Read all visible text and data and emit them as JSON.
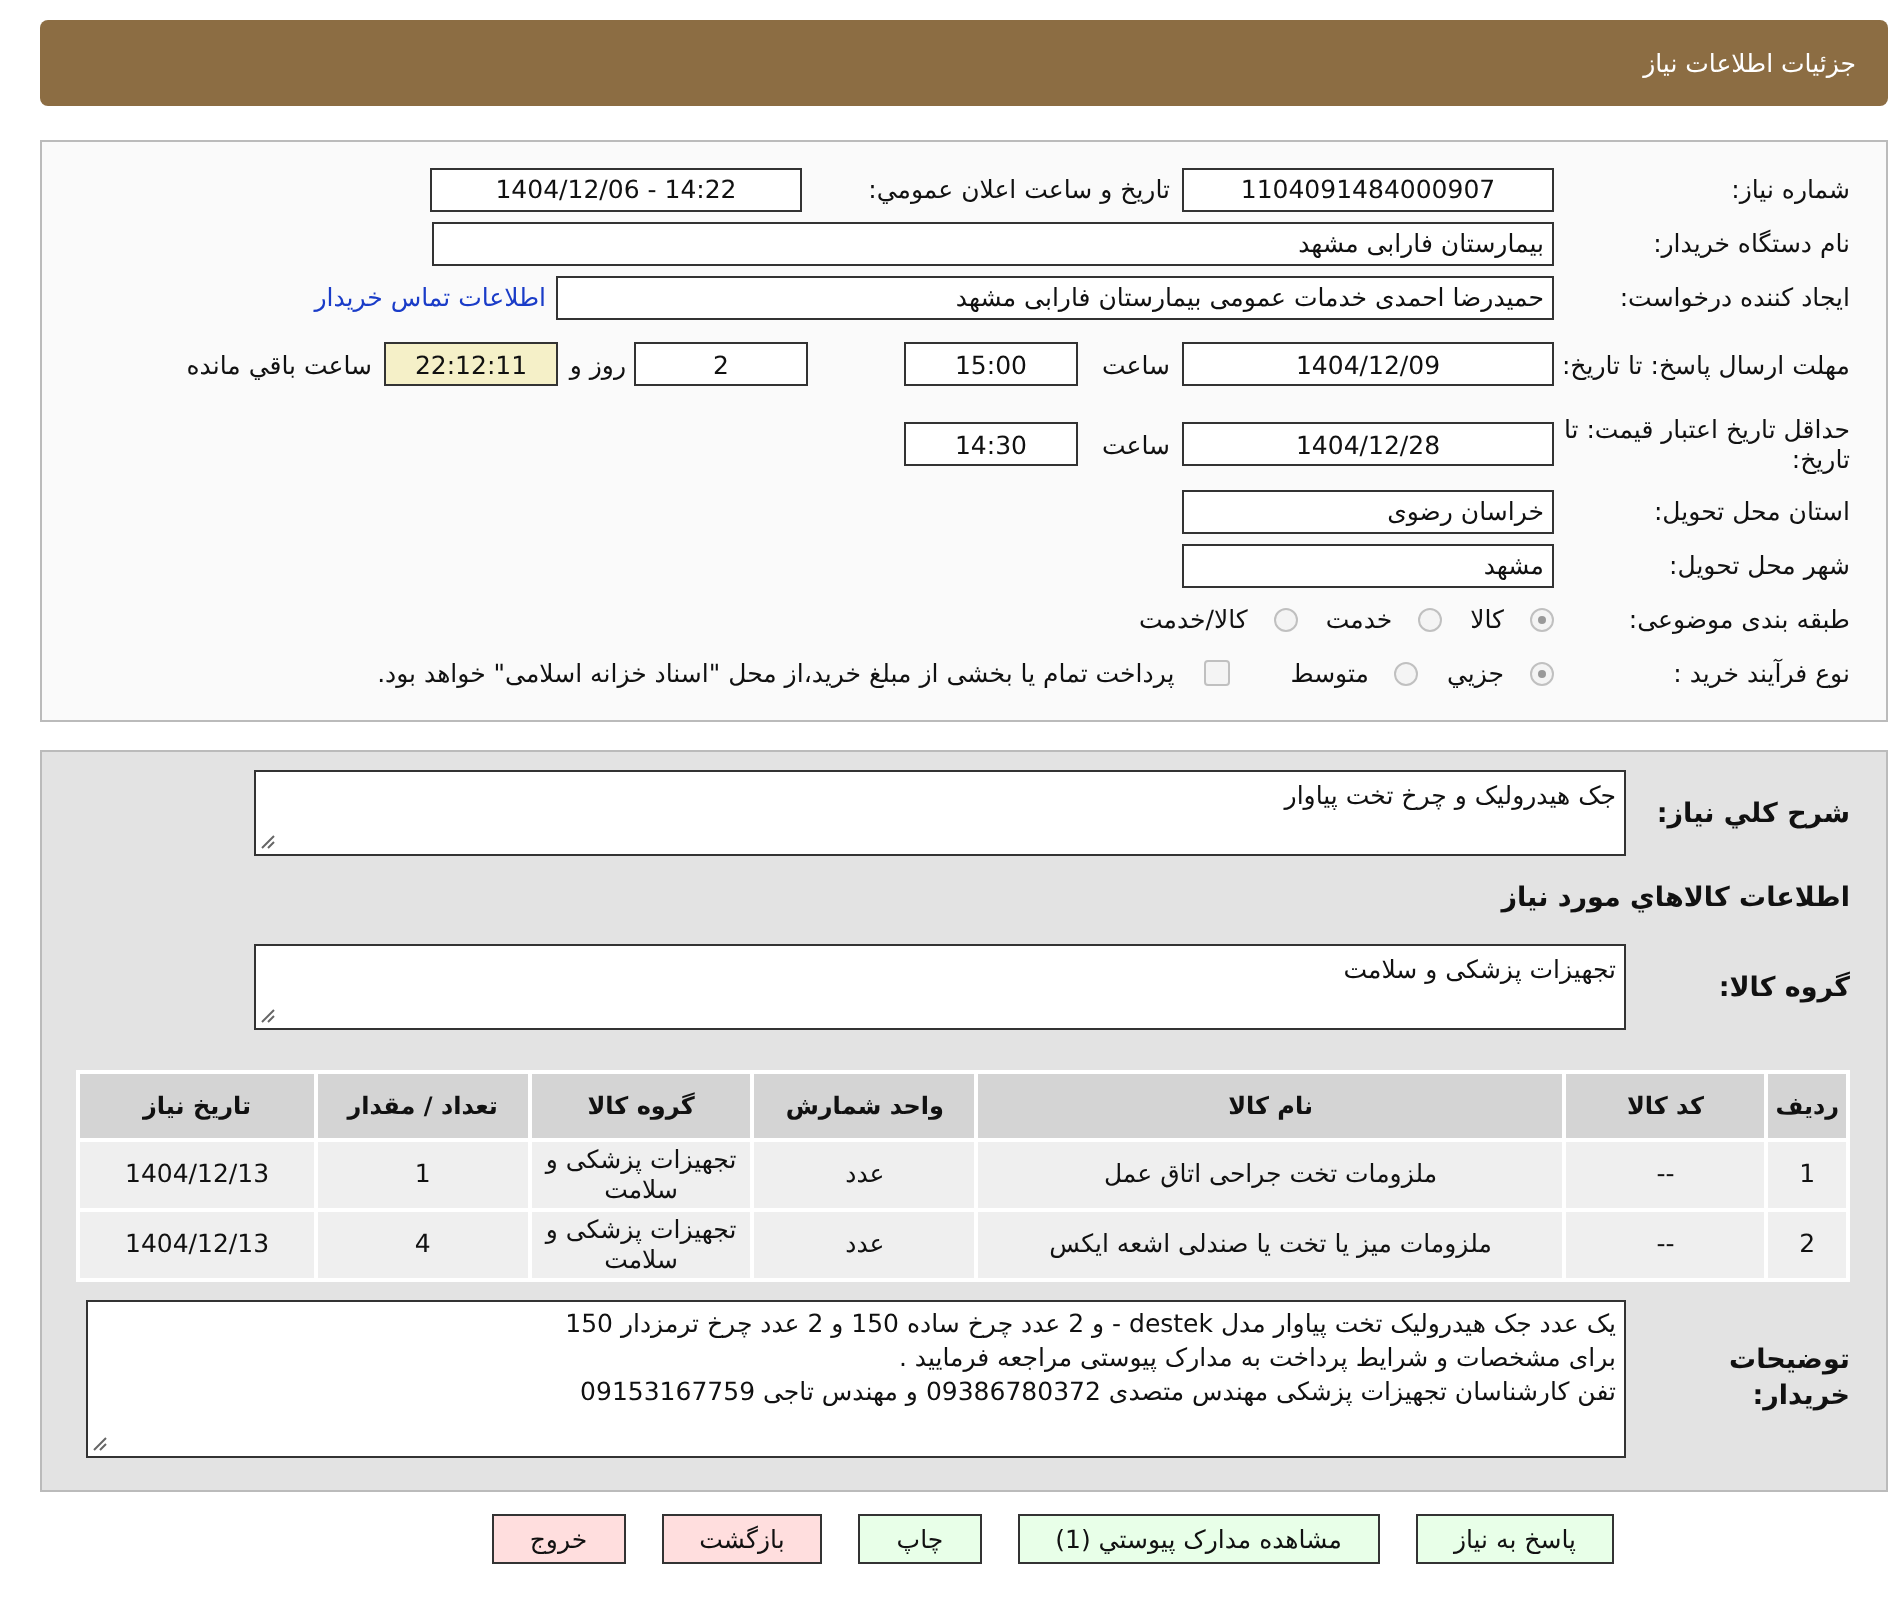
{
  "header": {
    "title": "جزئیات اطلاعات نیاز"
  },
  "need_number": {
    "label": "شماره نیاز:",
    "value": "1104091484000907"
  },
  "announce": {
    "label": "تاریخ و ساعت اعلان عمومي:",
    "value": "1404/12/06 - 14:22"
  },
  "buyer": {
    "label": "نام دستگاه خریدار:",
    "value": "بیمارستان فارابی مشهد"
  },
  "creator": {
    "label": "ایجاد کننده درخواست:",
    "value": "حمیدرضا احمدی خدمات عمومی بیمارستان فارابی مشهد",
    "link": "اطلاعات تماس خریدار"
  },
  "deadline": {
    "label": "مهلت ارسال پاسخ: تا تاریخ:",
    "date": "1404/12/09",
    "time_label": "ساعت",
    "time": "15:00",
    "days": "2",
    "days_label": "روز و",
    "remaining": "22:12:11",
    "remaining_label": "ساعت باقي مانده"
  },
  "validity": {
    "label": "حداقل تاریخ اعتبار قیمت: تا تاریخ:",
    "date": "1404/12/28",
    "time_label": "ساعت",
    "time": "14:30"
  },
  "province": {
    "label": "استان محل تحویل:",
    "value": "خراسان رضوی"
  },
  "city": {
    "label": "شهر محل تحویل:",
    "value": "مشهد"
  },
  "category": {
    "label": "طبقه بندی موضوعی:",
    "options": [
      {
        "label": "کالا",
        "selected": true
      },
      {
        "label": "خدمت",
        "selected": false
      },
      {
        "label": "کالا/خدمت",
        "selected": false
      }
    ]
  },
  "process": {
    "label": "نوع فرآیند خرید :",
    "options": [
      {
        "label": "جزيي",
        "selected": true
      },
      {
        "label": "متوسط",
        "selected": false
      }
    ],
    "payment": {
      "label": "پرداخت تمام یا بخشی از مبلغ خرید،از محل \"اسناد خزانه اسلامی\" خواهد بود.",
      "checked": false
    }
  },
  "summary": {
    "label": "شرح کلي نیاز:",
    "value": "جک هیدرولیک و چرخ تخت پیاوار"
  },
  "goods_title": "اطلاعات کالاهاي مورد نیاز",
  "goods_group": {
    "label": "گروه کالا:",
    "value": "تجهیزات پزشکی و سلامت"
  },
  "table": {
    "columns": [
      "ردیف",
      "کد کالا",
      "نام کالا",
      "واحد شمارش",
      "گروه کالا",
      "تعداد / مقدار",
      "تاریخ نیاز"
    ],
    "rows": [
      [
        "1",
        "--",
        "ملزومات تخت جراحی اتاق عمل",
        "عدد",
        "تجهیزات پزشکی و سلامت",
        "1",
        "1404/12/13"
      ],
      [
        "2",
        "--",
        "ملزومات میز یا تخت یا صندلی اشعه ایکس",
        "عدد",
        "تجهیزات پزشکی و سلامت",
        "4",
        "1404/12/13"
      ]
    ]
  },
  "buyer_notes": {
    "label": "توضیحات خریدار:",
    "lines": [
      "یک عدد جک هیدرولیک تخت پیاوار مدل destek - و 2 عدد چرخ ساده 150 و 2 عدد چرخ ترمزدار 150",
      "برای مشخصات و شرایط پرداخت به مدارک پیوستی مراجعه فرمایید .",
      "تفن کارشناسان تجهیزات پزشکی مهندس متصدی 09386780372  و مهندس تاجی 09153167759"
    ]
  },
  "buttons": [
    {
      "label": "پاسخ به نیاز",
      "kind": "action"
    },
    {
      "label": "مشاهده مدارک پیوستي (1)",
      "kind": "action"
    },
    {
      "label": "چاپ",
      "kind": "action"
    },
    {
      "label": "بازگشت",
      "kind": "exit"
    },
    {
      "label": "خروج",
      "kind": "exit"
    }
  ]
}
